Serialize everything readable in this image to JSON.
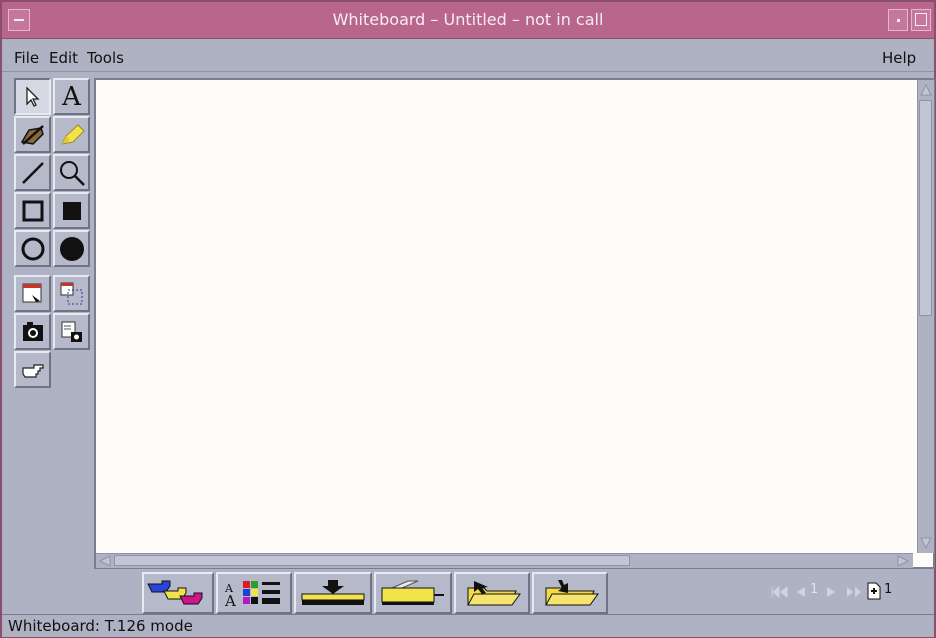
{
  "window": {
    "title": "Whiteboard – Untitled  – not in call"
  },
  "menubar": {
    "file": "File",
    "edit": "Edit",
    "tools": "Tools",
    "help": "Help"
  },
  "toolbox": {
    "text_tool_label": "A"
  },
  "pager": {
    "current_page": "1",
    "page_count": "1"
  },
  "status": {
    "text": "Whiteboard: T.126 mode"
  },
  "colors": {
    "titlebar": "#b9668d",
    "chrome": "#aeb2c3",
    "canvas": "#fdfcf8",
    "highlighter": "#f2e34a",
    "folder": "#f2d94a"
  }
}
